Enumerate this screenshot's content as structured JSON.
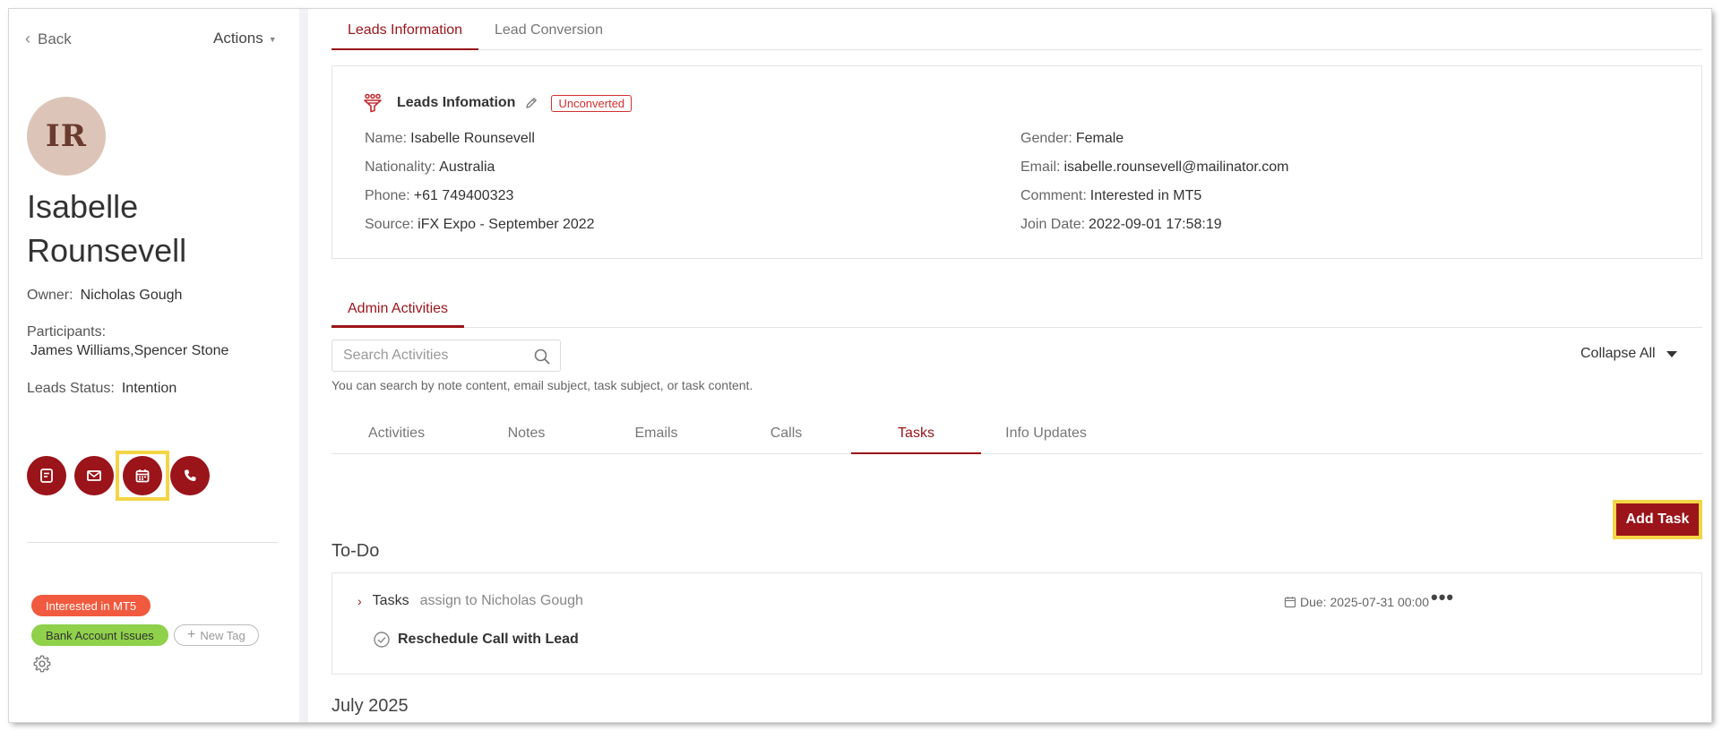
{
  "sidebar": {
    "back_label": "Back",
    "actions_label": "Actions",
    "avatar_initials": "IR",
    "lead_name": "Isabelle Rounsevell",
    "owner_label": "Owner:",
    "owner_value": "Nicholas Gough",
    "participants_label": "Participants:",
    "participants_value": "James Williams,Spencer Stone",
    "status_label": "Leads Status:",
    "status_value": "Intention",
    "quick_actions": [
      "note-icon",
      "email-icon",
      "calendar-icon",
      "phone-icon"
    ],
    "tags": [
      {
        "label": "Interested in MT5",
        "color": "#f15a3e"
      },
      {
        "label": "Bank Account Issues",
        "color": "#8fd14a"
      }
    ],
    "new_tag_label": "New Tag"
  },
  "top_tabs": [
    {
      "label": "Leads Information",
      "active": true
    },
    {
      "label": "Lead Conversion",
      "active": false
    }
  ],
  "info_card": {
    "title": "Leads Infomation",
    "status_badge": "Unconverted",
    "left_fields": [
      {
        "label": "Name:",
        "value": "Isabelle Rounsevell"
      },
      {
        "label": "Nationality:",
        "value": "Australia"
      },
      {
        "label": "Phone:",
        "value": "+61 749400323"
      },
      {
        "label": "Source:",
        "value": "iFX Expo - September 2022"
      }
    ],
    "right_fields": [
      {
        "label": "Gender:",
        "value": "Female"
      },
      {
        "label": "Email:",
        "value": "isabelle.rounsevell@mailinator.com"
      },
      {
        "label": "Comment:",
        "value": "Interested in MT5"
      },
      {
        "label": "Join Date:",
        "value": "2022-09-01 17:58:19"
      }
    ]
  },
  "admin": {
    "tab_label": "Admin Activities",
    "search_placeholder": "Search Activities",
    "search_hint": "You can search by note content, email subject, task subject, or task content.",
    "collapse_label": "Collapse All",
    "activity_tabs": [
      {
        "label": "Activities",
        "active": false
      },
      {
        "label": "Notes",
        "active": false
      },
      {
        "label": "Emails",
        "active": false
      },
      {
        "label": "Calls",
        "active": false
      },
      {
        "label": "Tasks",
        "active": true
      },
      {
        "label": "Info Updates",
        "active": false
      }
    ],
    "add_task_label": "Add Task"
  },
  "todo": {
    "section_title": "To-Do",
    "task_type": "Tasks",
    "assign_text": "assign to Nicholas Gough",
    "due_text": "Due: 2025-07-31 00:00",
    "task_title": "Reschedule Call with Lead",
    "more_label": "•••"
  },
  "history": {
    "section_title": "July 2025"
  },
  "colors": {
    "accent": "#9a1419",
    "highlight": "#f5d547",
    "avatar_bg": "#dcc5b8"
  }
}
